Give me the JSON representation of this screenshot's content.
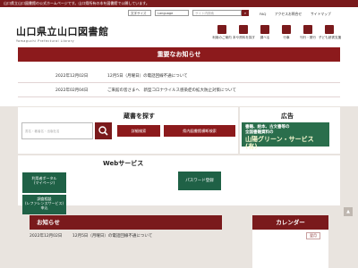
{
  "topbar": {
    "text": "山口県立山口図書館の公式ホームページです。山口県所有の本を図書館で公開しています。"
  },
  "header": {
    "logo_name": "山口県立山口図書館",
    "logo_sub": "Yamaguchi Prefectural Library",
    "font_size_label": "文字サイズ",
    "language_label": "Language",
    "search_placeholder": "サイト内検索",
    "links": [
      "FAQ",
      "アクセス",
      "お問合せ",
      "サイトマップ"
    ],
    "nav": [
      {
        "label": "利用のご案内",
        "icon": "person-icon"
      },
      {
        "label": "本や資料を探す",
        "icon": "book-search-icon"
      },
      {
        "label": "調べる",
        "icon": "document-icon"
      },
      {
        "label": "行事",
        "icon": "calendar-icon"
      },
      {
        "label": "刊行・発行",
        "icon": "books-icon"
      },
      {
        "label": "子ども読書支援",
        "icon": "child-icon"
      }
    ]
  },
  "notice": {
    "title": "重要なお知らせ",
    "items": [
      {
        "date": "2022年12月02日",
        "text": "12月5日（月曜日）の電話回線不通について"
      },
      {
        "date": "2022年02月04日",
        "text": "ご来館の皆さまへ　新型コロナウイルス感染症の拡大防止対策について"
      }
    ]
  },
  "search": {
    "title": "蔵書を探す",
    "placeholder": "書名・著者名・出版社名",
    "detail_button": "詳細検索",
    "catalog_button": "県内図書館横断検索"
  },
  "ad": {
    "title": "広告",
    "lines": [
      "書籍、絵本、古文書等の",
      "全国書籍資料の",
      "山陽グリーン・サービス(有)"
    ]
  },
  "web": {
    "title": "Webサービス",
    "portal_button": [
      "利用者ポータル",
      "(マイページ)"
    ],
    "reference_button": [
      "調査相談",
      "(レファレンスサービス)",
      "申込"
    ],
    "password_button": "パスワード登録"
  },
  "news": {
    "title": "お知らせ",
    "item_date": "2022年12月02日",
    "item_text": "12月5日（月曜日）の電話回線不通について"
  },
  "calendar": {
    "title": "カレンダー",
    "tab": "翌月"
  },
  "colors": {
    "brand": "#7a1a1c",
    "green": "#1f6146",
    "background": "#e9e4df"
  }
}
